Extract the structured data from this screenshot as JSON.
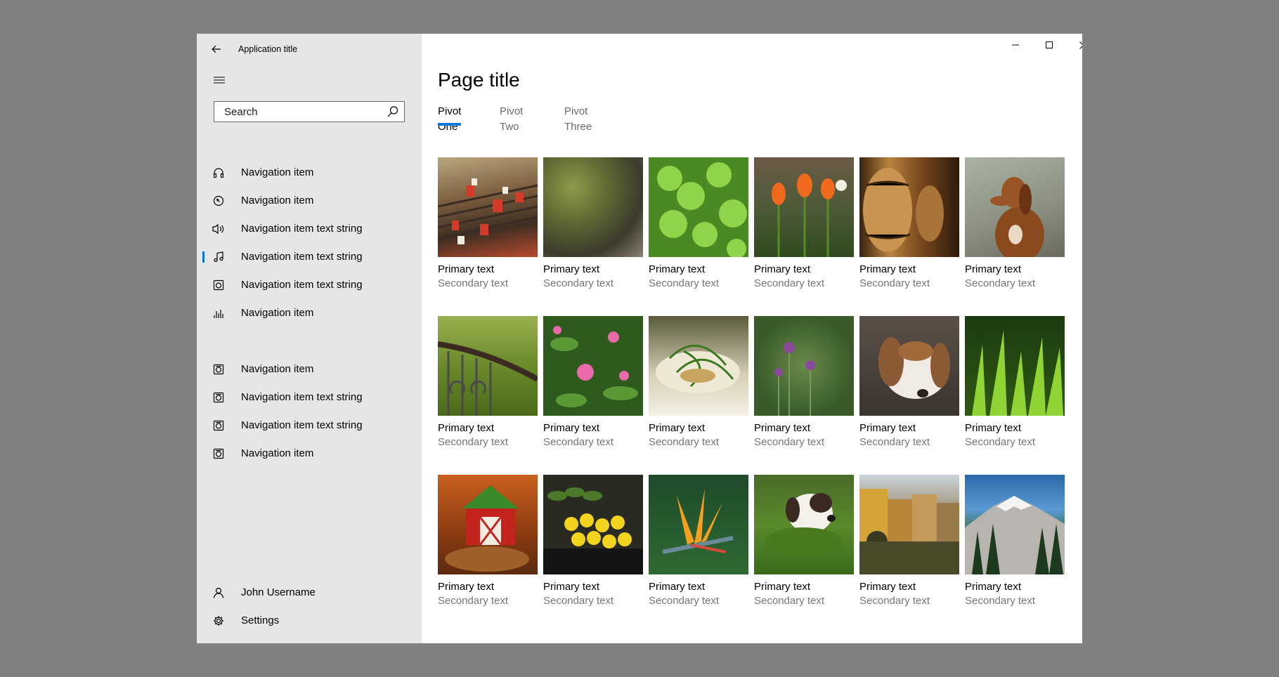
{
  "window": {
    "app_title": "Application title",
    "page_title": "Page title",
    "accent_color": "#0078d7",
    "pane_color": "#e6e6e6"
  },
  "search": {
    "placeholder": "Search"
  },
  "nav": {
    "items": [
      {
        "label": "Navigation item",
        "icon": "headphones-icon"
      },
      {
        "label": "Navigation item",
        "icon": "compass-icon"
      },
      {
        "label": "Navigation item text string",
        "icon": "speaker-icon"
      },
      {
        "label": "Navigation item text string",
        "icon": "music-note-icon",
        "selected": true
      },
      {
        "label": "Navigation item text string",
        "icon": "device-icon"
      },
      {
        "label": "Navigation item",
        "icon": "equalizer-icon"
      },
      {
        "label": "Navigation item",
        "icon": "device-icon"
      },
      {
        "label": "Navigation item text string",
        "icon": "device-icon"
      },
      {
        "label": "Navigation item text string",
        "icon": "device-icon"
      },
      {
        "label": "Navigation item",
        "icon": "device-icon"
      }
    ],
    "user": {
      "label": "John Username",
      "icon": "person-icon"
    },
    "settings": {
      "label": "Settings",
      "icon": "gear-icon"
    }
  },
  "pivots": [
    {
      "label": "Pivot One",
      "selected": true
    },
    {
      "label": "Pivot Two",
      "selected": false
    },
    {
      "label": "Pivot Three",
      "selected": false
    }
  ],
  "gallery": {
    "items": [
      {
        "primary": "Primary text",
        "secondary": "Secondary text",
        "image": "rebar bundles with red tags"
      },
      {
        "primary": "Primary text",
        "secondary": "Secondary text",
        "image": "moss on tree bark"
      },
      {
        "primary": "Primary text",
        "secondary": "Secondary text",
        "image": "green clover leaves"
      },
      {
        "primary": "Primary text",
        "secondary": "Secondary text",
        "image": "orange tulips"
      },
      {
        "primary": "Primary text",
        "secondary": "Secondary text",
        "image": "wooden barrels"
      },
      {
        "primary": "Primary text",
        "secondary": "Secondary text",
        "image": "dachshund dog"
      },
      {
        "primary": "Primary text",
        "secondary": "Secondary text",
        "image": "iron railing and moss"
      },
      {
        "primary": "Primary text",
        "secondary": "Secondary text",
        "image": "pink azalea flowers"
      },
      {
        "primary": "Primary text",
        "secondary": "Secondary text",
        "image": "plated food with greens"
      },
      {
        "primary": "Primary text",
        "secondary": "Secondary text",
        "image": "thistle buds"
      },
      {
        "primary": "Primary text",
        "secondary": "Secondary text",
        "image": "basset hound"
      },
      {
        "primary": "Primary text",
        "secondary": "Secondary text",
        "image": "green grass blades"
      },
      {
        "primary": "Primary text",
        "secondary": "Secondary text",
        "image": "red barn birdhouse"
      },
      {
        "primary": "Primary text",
        "secondary": "Secondary text",
        "image": "lemons and cucumbers at market"
      },
      {
        "primary": "Primary text",
        "secondary": "Secondary text",
        "image": "bird of paradise flower"
      },
      {
        "primary": "Primary text",
        "secondary": "Secondary text",
        "image": "dog lying in grass"
      },
      {
        "primary": "Primary text",
        "secondary": "Secondary text",
        "image": "old town buildings by river"
      },
      {
        "primary": "Primary text",
        "secondary": "Secondary text",
        "image": "snowy mountain and forest"
      }
    ]
  }
}
